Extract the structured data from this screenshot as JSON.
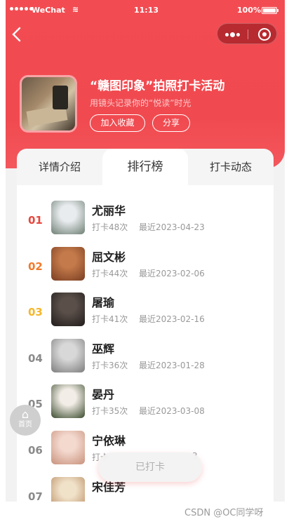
{
  "status_bar": {
    "carrier": "WeChat",
    "time": "11:13",
    "battery": "100%"
  },
  "activity": {
    "title": "“赣图印象”拍照打卡活动",
    "subtitle": "用镜头记录你的“悦读”时光",
    "favorite_label": "加入收藏",
    "share_label": "分享"
  },
  "tabs": [
    {
      "label": "详情介绍",
      "active": false
    },
    {
      "label": "排行榜",
      "active": true
    },
    {
      "label": "打卡动态",
      "active": false
    }
  ],
  "ranking": [
    {
      "rank": "01",
      "name": "尤丽华",
      "checkins": "打卡48次",
      "last": "最近2023-04-23",
      "rank_color": "#e8473e",
      "avatar": [
        "#e9ecef",
        "#6e7f74"
      ]
    },
    {
      "rank": "02",
      "name": "屈文彬",
      "checkins": "打卡44次",
      "last": "最近2023-02-06",
      "rank_color": "#f07a2b",
      "avatar": [
        "#c47a4a",
        "#7a3e22"
      ]
    },
    {
      "rank": "03",
      "name": "屠瑜",
      "checkins": "打卡41次",
      "last": "最近2023-02-16",
      "rank_color": "#f5b62a",
      "avatar": [
        "#5a4f49",
        "#211c1b"
      ]
    },
    {
      "rank": "04",
      "name": "巫辉",
      "checkins": "打卡36次",
      "last": "最近2023-01-28",
      "rank_color": "#8a8a8a",
      "avatar": [
        "#d8d8d8",
        "#7d7d7d"
      ]
    },
    {
      "rank": "05",
      "name": "晏丹",
      "checkins": "打卡35次",
      "last": "最近2023-03-08",
      "rank_color": "#8a8a8a",
      "avatar": [
        "#f2ede6",
        "#3a4b2e"
      ]
    },
    {
      "rank": "06",
      "name": "宁依琳",
      "checkins": "打卡",
      "last": "3",
      "rank_color": "#8a8a8a",
      "avatar": [
        "#f4d9cf",
        "#c8927c"
      ]
    },
    {
      "rank": "07",
      "name": "宋佳芳",
      "checkins": "",
      "last": "",
      "rank_color": "#8a8a8a",
      "avatar": [
        "#f0e1c9",
        "#b78a5e"
      ]
    }
  ],
  "home_fab": {
    "label": "首页",
    "icon": "home-icon"
  },
  "checked_button": "已打卡",
  "watermark": "CSDN @OC同学呀"
}
